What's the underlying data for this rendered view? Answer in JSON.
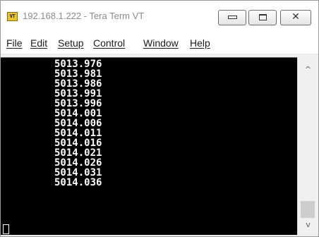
{
  "window": {
    "app_icon_text": "VT",
    "title": "192.168.1.222 - Tera Term VT"
  },
  "title_buttons": {
    "minimize_icon": "minimize-icon",
    "maximize_icon": "maximize-icon",
    "close_glyph": "✕"
  },
  "menu": {
    "items": [
      {
        "label": "File"
      },
      {
        "label": "Edit"
      },
      {
        "label": "Setup"
      },
      {
        "label": "Control"
      },
      {
        "label": "Window"
      },
      {
        "label": "Help"
      }
    ]
  },
  "terminal": {
    "background": "#000000",
    "foreground": "#ffffff",
    "lines": [
      "5013.976",
      "5013.981",
      "5013.986",
      "5013.991",
      "5013.996",
      "5014.001",
      "5014.006",
      "5014.011",
      "5014.016",
      "5014.021",
      "5014.026",
      "5014.031",
      "5014.036"
    ]
  },
  "scrollbar": {
    "up_arrow": "^",
    "down_arrow": "v",
    "position_fraction": 1.0
  }
}
